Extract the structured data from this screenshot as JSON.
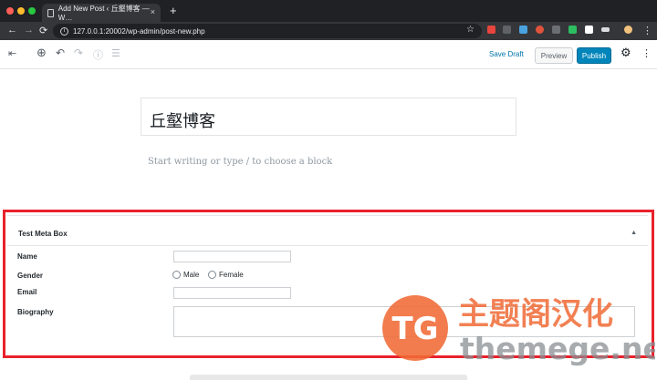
{
  "browser": {
    "tab_title": "Add New Post ‹ 丘壑博客 — W…",
    "tab_close": "×",
    "new_tab": "+",
    "url": "127.0.0.1:20002/wp-admin/post-new.php",
    "nav": {
      "back": "←",
      "forward": "→",
      "reload": "⟳"
    },
    "star": "☆",
    "menu": "⋮"
  },
  "editor_toolbar": {
    "sidebar_toggle": "⇤",
    "add_block": "⊕",
    "undo": "↶",
    "redo": "↷",
    "info": "ⓘ",
    "outline": "☰",
    "save_draft": "Save Draft",
    "preview": "Preview",
    "publish": "Publish",
    "settings": "⚙",
    "more": "⋮"
  },
  "post": {
    "title": "丘壑博客",
    "block_placeholder": "Start writing or type / to choose a block"
  },
  "meta_box": {
    "title": "Test Meta Box",
    "toggle": "▲",
    "fields": {
      "name_label": "Name",
      "gender_label": "Gender",
      "male_label": "Male",
      "female_label": "Female",
      "email_label": "Email",
      "biography_label": "Biography"
    }
  },
  "watermark": {
    "logo": "TG",
    "cn_text": "主题阁汉化",
    "en_text": "themege.net"
  },
  "colors": {
    "highlight_frame": "#e8212b",
    "publish": "#0085ba",
    "link": "#0073aa",
    "watermark_orange": "#f06a36"
  }
}
